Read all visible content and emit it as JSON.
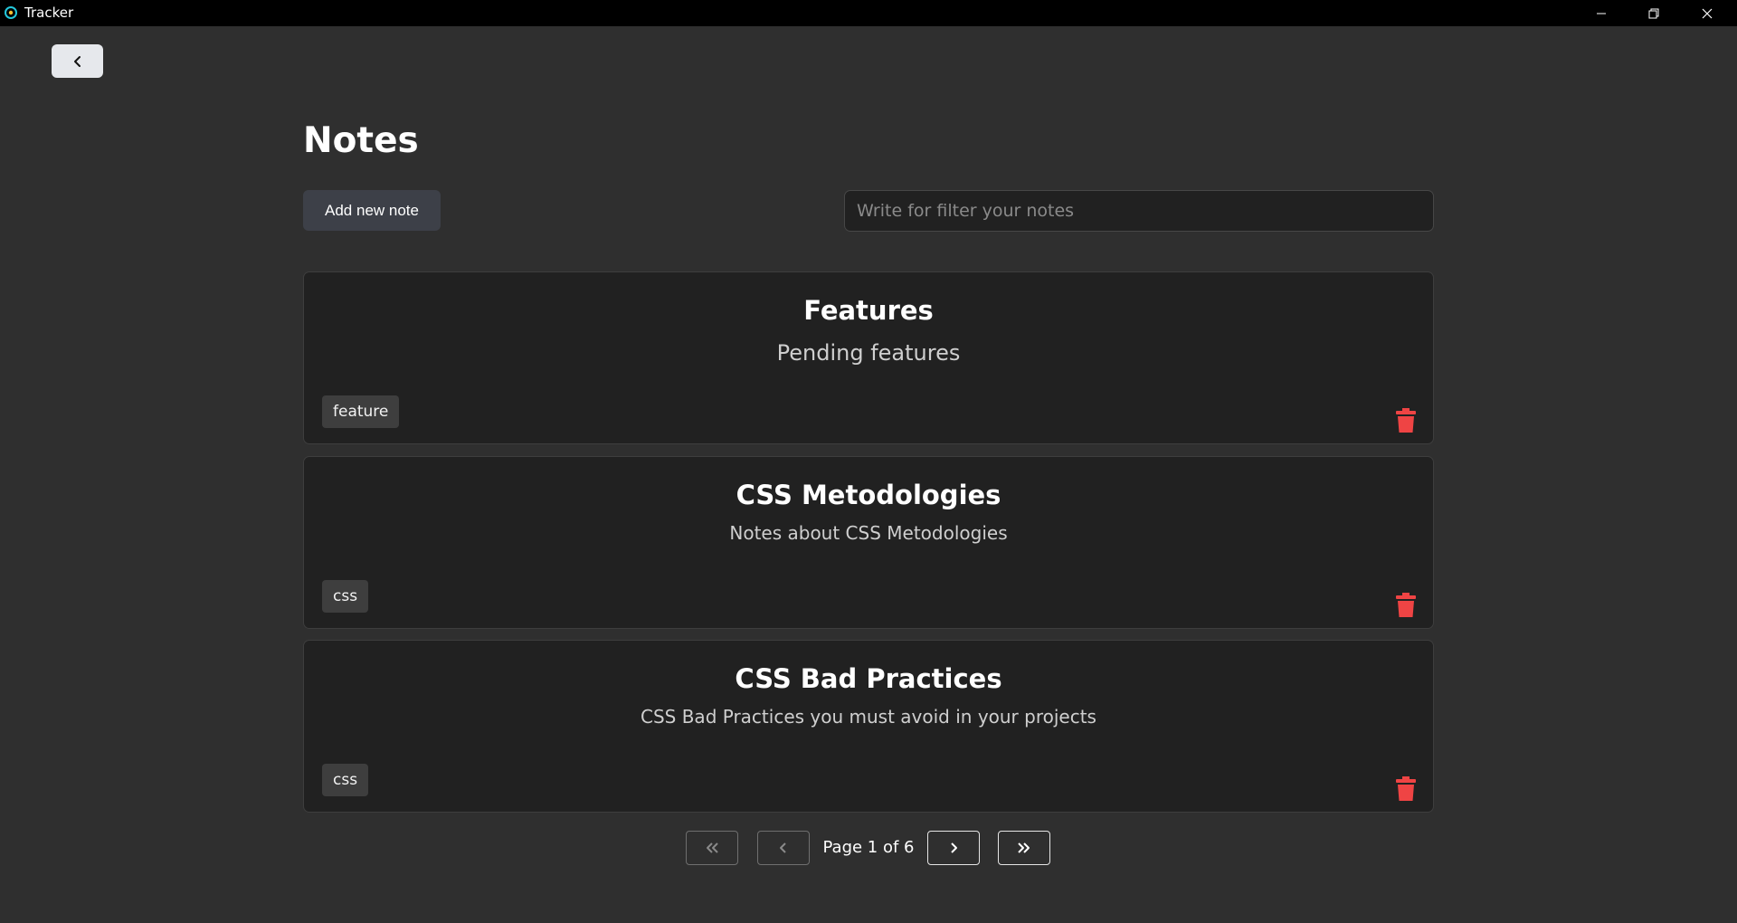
{
  "window": {
    "title": "Tracker"
  },
  "page": {
    "title": "Notes",
    "add_button_label": "Add new note",
    "search": {
      "placeholder": "Write for filter your notes",
      "value": ""
    }
  },
  "notes": [
    {
      "title": "Features",
      "description": "Pending features",
      "tag": "feature"
    },
    {
      "title": "CSS Metodologies",
      "description": "Notes about CSS Metodologies",
      "tag": "css"
    },
    {
      "title": "CSS Bad Practices",
      "description": "CSS Bad Practices you must avoid in your projects",
      "tag": "css"
    }
  ],
  "pagination": {
    "label": "Page 1 of 6",
    "current_page": 1,
    "total_pages": 6
  },
  "colors": {
    "background": "#2f2f2f",
    "card": "#212121",
    "delete": "#ef4444",
    "titlebar": "#000000"
  },
  "icons": {
    "back": "chevron-left-icon",
    "delete": "trash-icon",
    "first": "chevrons-left-icon",
    "prev": "chevron-left-icon",
    "next": "chevron-right-icon",
    "last": "chevrons-right-icon"
  }
}
